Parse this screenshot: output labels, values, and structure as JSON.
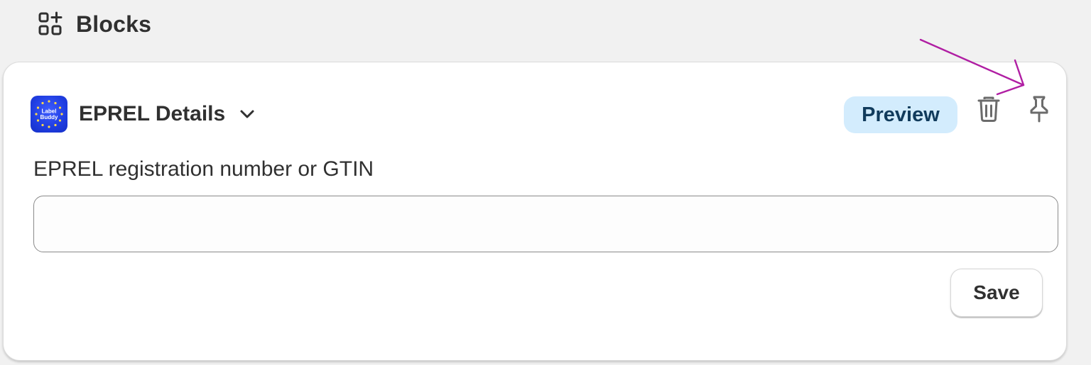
{
  "section": {
    "title": "Blocks",
    "icon": "blocks-add-icon"
  },
  "block": {
    "title": "EPREL Details",
    "app_logo_icon": "label-buddy-logo",
    "app_logo_text_line1": "Label",
    "app_logo_text_line2": "Buddy",
    "expand_icon": "chevron-down-icon",
    "preview_label": "Preview",
    "delete_icon": "trash-icon",
    "pin_icon": "pin-icon"
  },
  "form": {
    "field_label": "EPREL registration number or GTIN",
    "field_value": "",
    "field_placeholder": "",
    "save_label": "Save"
  },
  "colors": {
    "background": "#f1f1f1",
    "card": "#ffffff",
    "preview_badge_bg": "#d3ecfd",
    "preview_badge_text": "#113b5c",
    "logo_blue": "#1f3de0",
    "annotation_arrow": "#b01ea3"
  }
}
